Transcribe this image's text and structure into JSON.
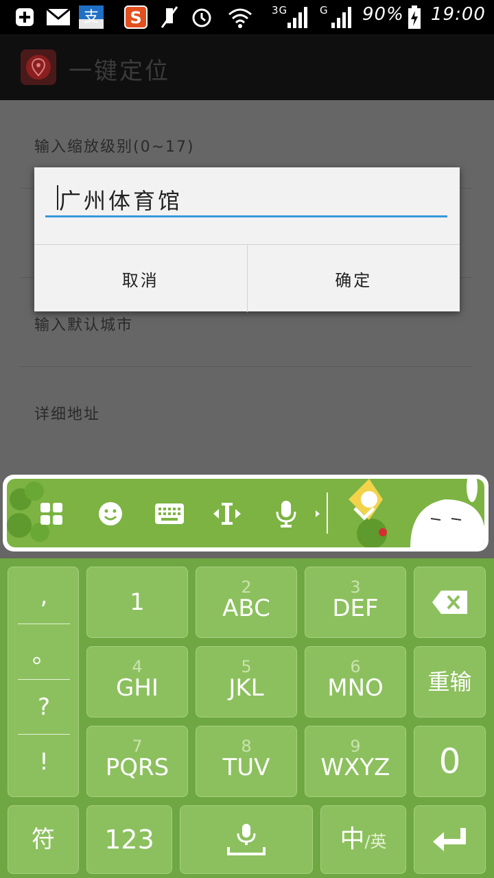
{
  "status_bar": {
    "battery": "90%",
    "time": "19:00",
    "network_3g": "3G",
    "network_g": "G"
  },
  "app": {
    "title": "一键定位"
  },
  "preferences": {
    "zoom_label": "输入缩放级别(0~17)",
    "city_label": "输入默认城市",
    "address_label": "详细地址"
  },
  "dialog": {
    "input_value": "广州体育馆",
    "cancel_label": "取消",
    "ok_label": "确定"
  },
  "keyboard": {
    "punctuation": [
      ",",
      "。",
      "?",
      "!"
    ],
    "keys": {
      "k1": {
        "num": "",
        "main": "1"
      },
      "k2": {
        "num": "2",
        "main": "ABC"
      },
      "k3": {
        "num": "3",
        "main": "DEF"
      },
      "k4": {
        "num": "4",
        "main": "GHI"
      },
      "k5": {
        "num": "5",
        "main": "JKL"
      },
      "k6": {
        "num": "6",
        "main": "MNO"
      },
      "k7": {
        "num": "7",
        "main": "PQRS"
      },
      "k8": {
        "num": "8",
        "main": "TUV"
      },
      "k9": {
        "num": "9",
        "main": "WXYZ"
      }
    },
    "reinput_label": "重输",
    "zero_label": "0",
    "symbol_label": "符",
    "num_mode_label": "123",
    "lang_main": "中",
    "lang_sub": "/英"
  },
  "icons": {
    "toolbar": [
      "grid-icon",
      "emoji-icon",
      "keyboard-icon",
      "cursor-move-icon",
      "mic-icon",
      "collapse-icon"
    ],
    "status": [
      "add-icon",
      "mail-icon",
      "alipay-icon",
      "sogou-icon",
      "mute-icon",
      "alarm-icon",
      "wifi-icon",
      "signal-icon",
      "battery-icon"
    ]
  },
  "colors": {
    "keyboard_bg": "#6fa843",
    "key_bg": "#8cc05e",
    "accent": "#3498db"
  }
}
